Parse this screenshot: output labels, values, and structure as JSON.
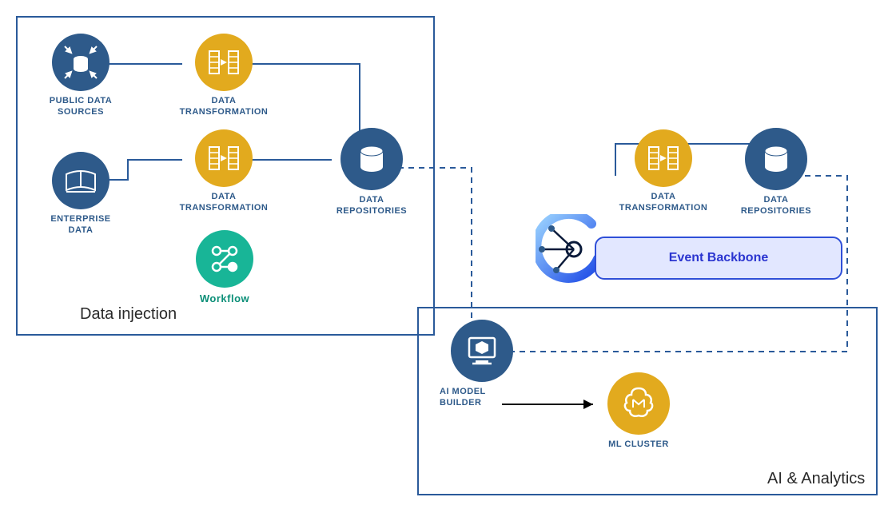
{
  "boxes": {
    "left": {
      "title": "Data injection"
    },
    "right": {
      "title": "AI & Analytics"
    }
  },
  "nodes": {
    "public_data": {
      "label": "PUBLIC  DATA\nSOURCES"
    },
    "enterprise_data": {
      "label": "ENTERPRISE\nDATA"
    },
    "data_transformation_1": {
      "label": "DATA\nTRANSFORMATION"
    },
    "data_transformation_2": {
      "label": "DATA\nTRANSFORMATION"
    },
    "workflow": {
      "label": "Workflow"
    },
    "data_repositories_left": {
      "label": "DATA\nREPOSITORIES"
    },
    "data_transformation_3": {
      "label": "DATA\nTRANSFORMATION"
    },
    "data_repositories_right": {
      "label": "DATA\nREPOSITORIES"
    },
    "ai_model_builder": {
      "label": "AI MODEL\nBUILDER"
    },
    "ml_cluster": {
      "label": "ML CLUSTER"
    }
  },
  "event_backbone": {
    "label": "Event Backbone"
  },
  "colors": {
    "navy": "#2e5a8a",
    "gold": "#e2aa1e",
    "teal": "#18b597",
    "border": "#2a5a9a",
    "eventFill": "#e2e7ff",
    "eventBorder": "#2f4fd8",
    "eventText": "#2b35d0"
  }
}
